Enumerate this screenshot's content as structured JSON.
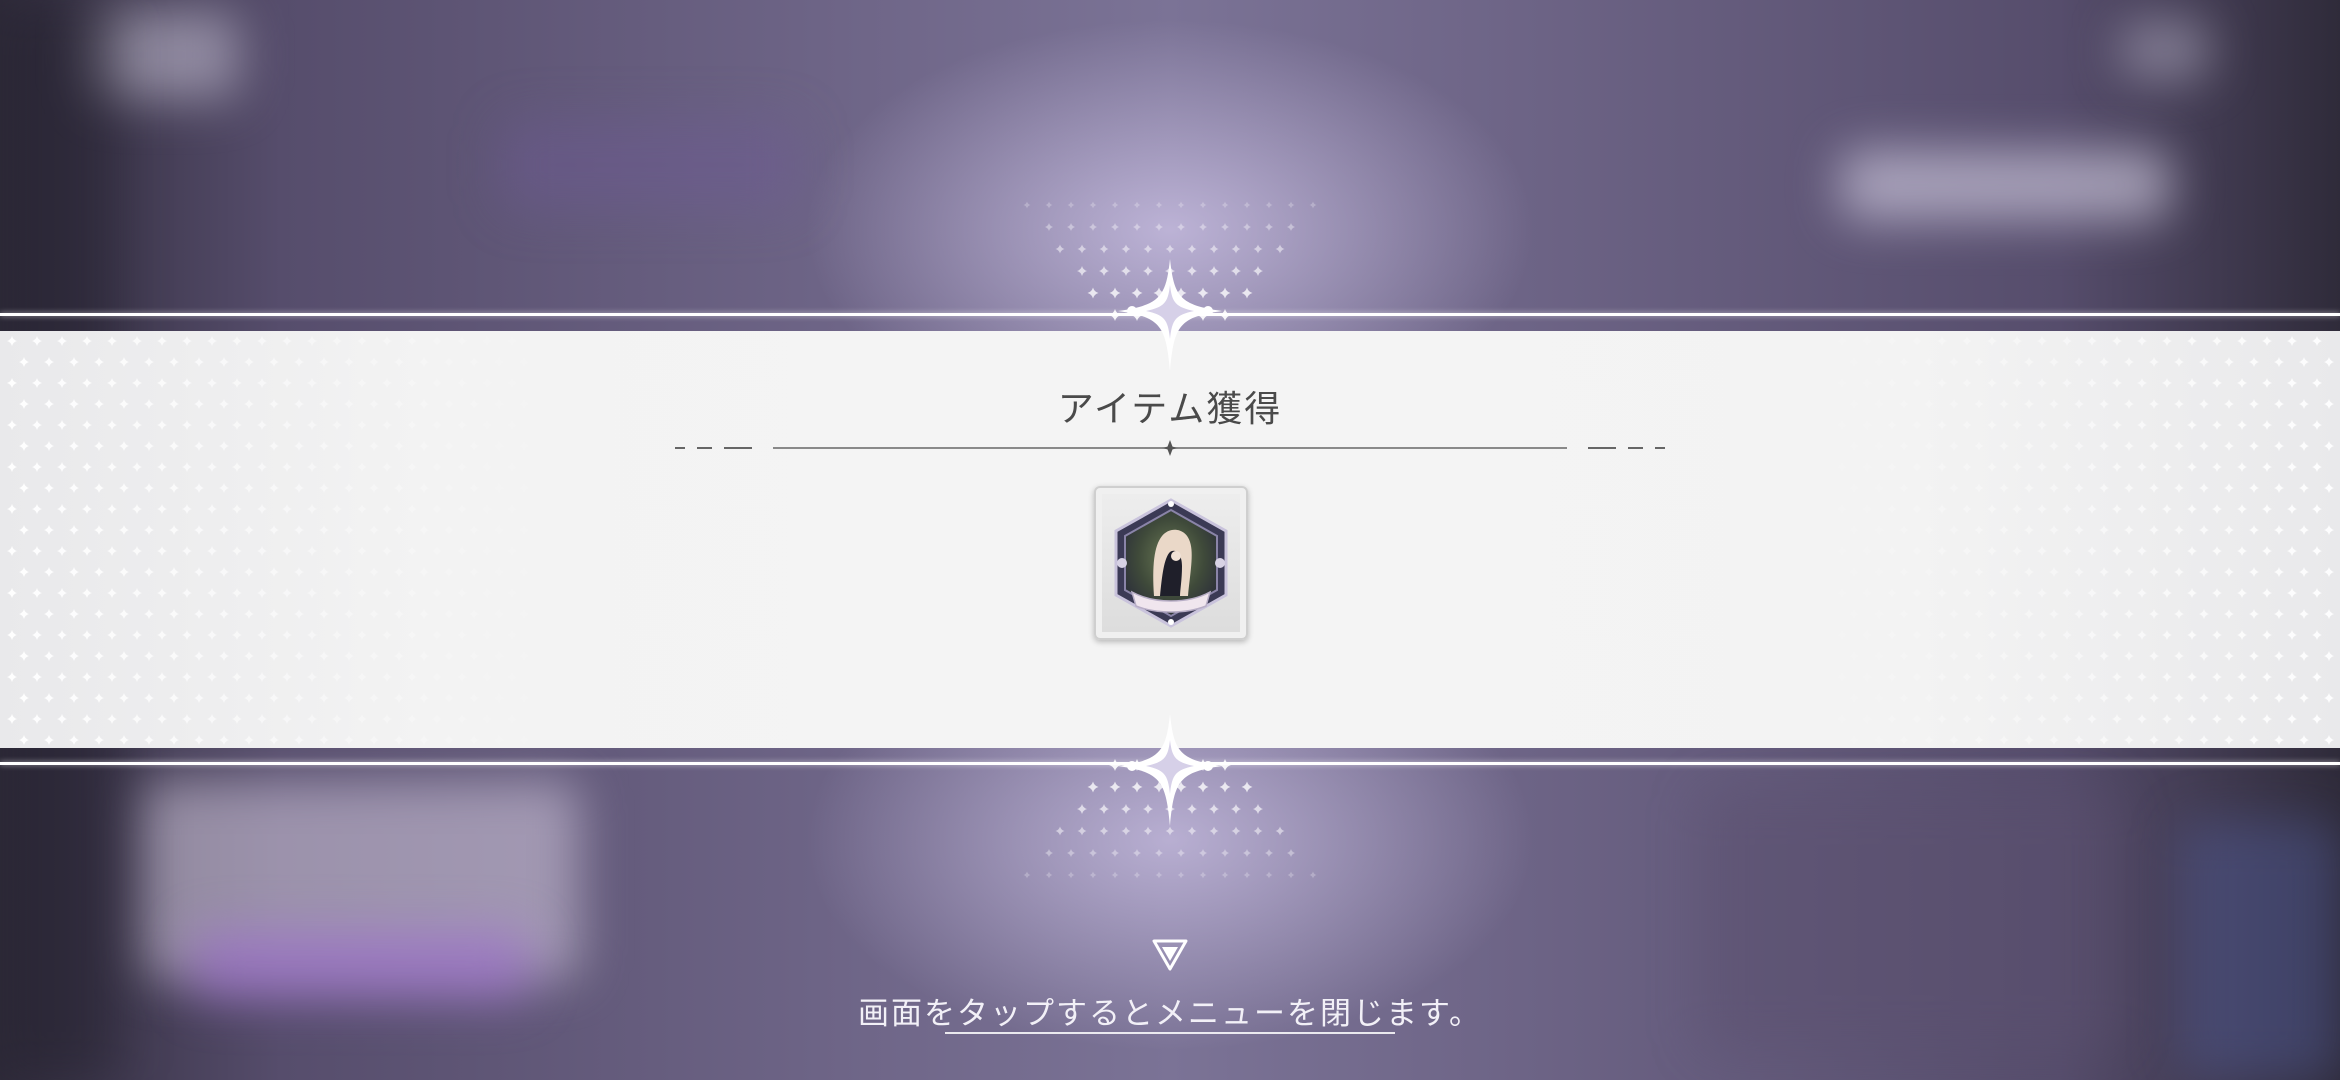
{
  "dialog": {
    "title": "アイテム獲得",
    "item": {
      "icon": "hexagonal-character-medal-icon"
    }
  },
  "footer": {
    "close_hint": "画面をタップするとメニューを閉じます。",
    "arrow_icon": "down-triangle-icon"
  },
  "colors": {
    "band": "#f4f4f4",
    "title_text": "#4a4a4a",
    "background_tint": "#6d6486",
    "hint_text": "#f2f0f7"
  }
}
